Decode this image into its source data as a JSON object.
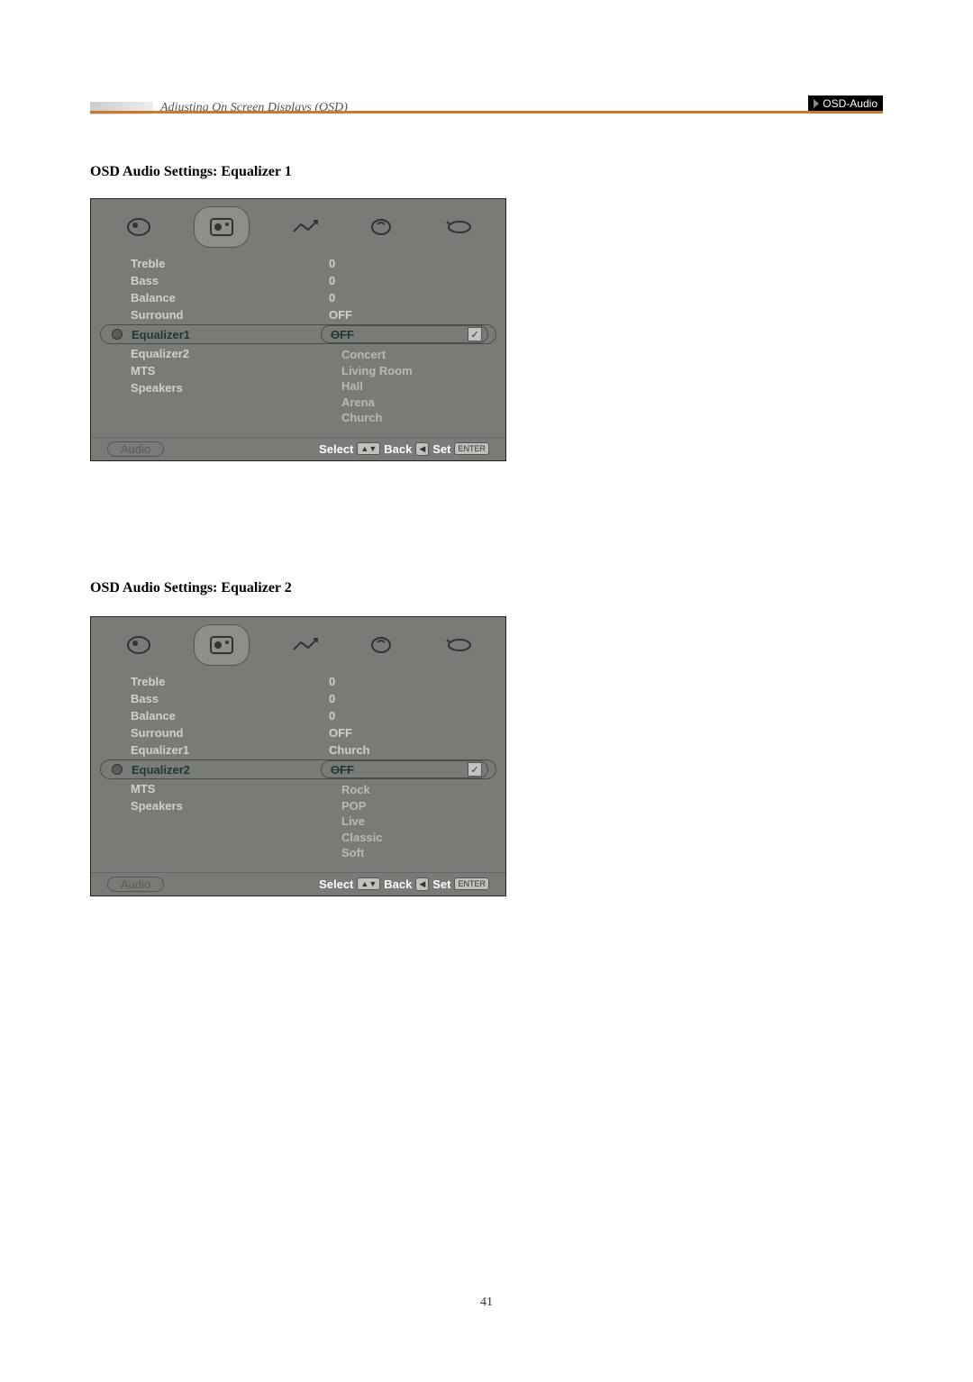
{
  "header": {
    "breadcrumb": "Adjusting On Screen Displays (OSD)",
    "tag": "OSD-Audio"
  },
  "section1": {
    "title": "OSD Audio Settings: Equalizer 1",
    "osd": {
      "category": "Audio",
      "rows": {
        "treble": {
          "label": "Treble",
          "value": "0"
        },
        "bass": {
          "label": "Bass",
          "value": "0"
        },
        "balance": {
          "label": "Balance",
          "value": "0"
        },
        "surround": {
          "label": "Surround",
          "value": "OFF"
        }
      },
      "selected": {
        "label": "Equalizer1",
        "value": "OFF"
      },
      "below": {
        "eq2": "Equalizer2",
        "mts": "MTS",
        "spk": "Speakers"
      },
      "dropdown": [
        "Concert",
        "Living Room",
        "Hall",
        "Arena",
        "Church"
      ],
      "footer": {
        "select": "Select",
        "back": "Back",
        "set": "Set",
        "updown": "▲▼",
        "left": "◀",
        "enter": "ENTER"
      }
    }
  },
  "section2": {
    "title": "OSD Audio Settings: Equalizer 2",
    "osd": {
      "category": "Audio",
      "rows": {
        "treble": {
          "label": "Treble",
          "value": "0"
        },
        "bass": {
          "label": "Bass",
          "value": "0"
        },
        "balance": {
          "label": "Balance",
          "value": "0"
        },
        "surround": {
          "label": "Surround",
          "value": "OFF"
        },
        "eq1": {
          "label": "Equalizer1",
          "value": "Church"
        }
      },
      "selected": {
        "label": "Equalizer2",
        "value": "OFF"
      },
      "below": {
        "mts": "MTS",
        "spk": "Speakers"
      },
      "dropdown": [
        "Rock",
        "POP",
        "Live",
        "Classic",
        "Soft"
      ],
      "footer": {
        "select": "Select",
        "back": "Back",
        "set": "Set",
        "updown": "▲▼",
        "left": "◀",
        "enter": "ENTER"
      }
    }
  },
  "page_number": "41",
  "tab_icons": [
    "picture-icon",
    "audio-icon",
    "management-icon",
    "source-icon",
    "exit-icon"
  ]
}
